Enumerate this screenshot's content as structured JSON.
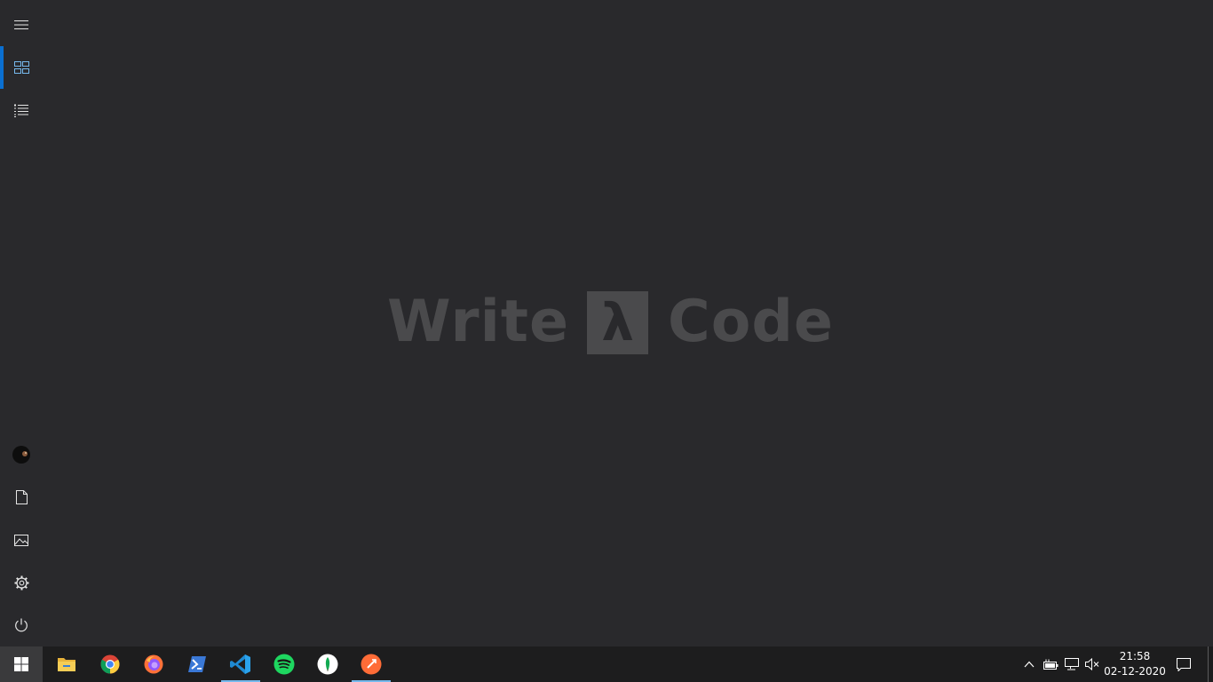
{
  "rail": {
    "top": [
      {
        "name": "menu-icon",
        "label": "Expand"
      },
      {
        "name": "tiles-icon",
        "label": "Pinned tiles",
        "active": true
      },
      {
        "name": "all-apps-list-icon",
        "label": "All apps"
      }
    ],
    "bottom": [
      {
        "name": "user-avatar",
        "label": "User"
      },
      {
        "name": "documents-icon",
        "label": "Documents"
      },
      {
        "name": "pictures-icon",
        "label": "Pictures"
      },
      {
        "name": "settings-gear-icon",
        "label": "Settings"
      },
      {
        "name": "power-icon",
        "label": "Power"
      }
    ]
  },
  "logo": {
    "left_word": "Write",
    "symbol": "λ",
    "right_word": "Code",
    "color": "#4a4a4c"
  },
  "taskbar": {
    "apps": [
      {
        "name": "file-explorer-icon",
        "running": false
      },
      {
        "name": "chrome-icon",
        "running": false
      },
      {
        "name": "firefox-icon",
        "running": false
      },
      {
        "name": "powershell-icon",
        "running": false
      },
      {
        "name": "vscode-icon",
        "running": true
      },
      {
        "name": "spotify-icon",
        "running": false
      },
      {
        "name": "mongodb-compass-icon",
        "running": false
      },
      {
        "name": "postman-icon",
        "running": true
      }
    ],
    "tray": [
      "chevron-up-icon",
      "battery-icon",
      "network-icon",
      "volume-muted-icon"
    ],
    "time": "21:58",
    "date": "02-12-2020"
  },
  "colors": {
    "background": "#29292c",
    "taskbar": "#1d1d1e",
    "accent": "#0a6fd1",
    "running_indicator": "#76b9ed"
  }
}
